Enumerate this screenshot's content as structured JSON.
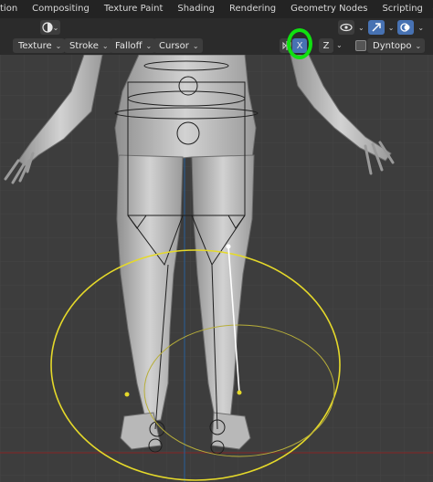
{
  "topbar": {
    "tabs": [
      "tion",
      "Compositing",
      "Texture Paint",
      "Shading",
      "Rendering",
      "Geometry Nodes",
      "Scripting"
    ],
    "add_label": "+"
  },
  "header": {
    "mode_icon": "sculpt-mode-icon",
    "right_icons": [
      "visibility-eye-icon",
      "gizmo-icon",
      "overlay-icon"
    ]
  },
  "toolbar": {
    "texture_label": "Texture",
    "stroke_label": "Stroke",
    "falloff_label": "Falloff",
    "cursor_label": "Cursor",
    "symmetry_x_label": "X",
    "symmetry_z_label": "Z",
    "dyntopo_label": "Dyntopo",
    "chevron": "⌄"
  },
  "colors": {
    "accent_blue": "#4772b3",
    "highlight_green": "#10e010",
    "brush_yellow": "#e5d92a",
    "stroke_white": "#ffffff"
  }
}
